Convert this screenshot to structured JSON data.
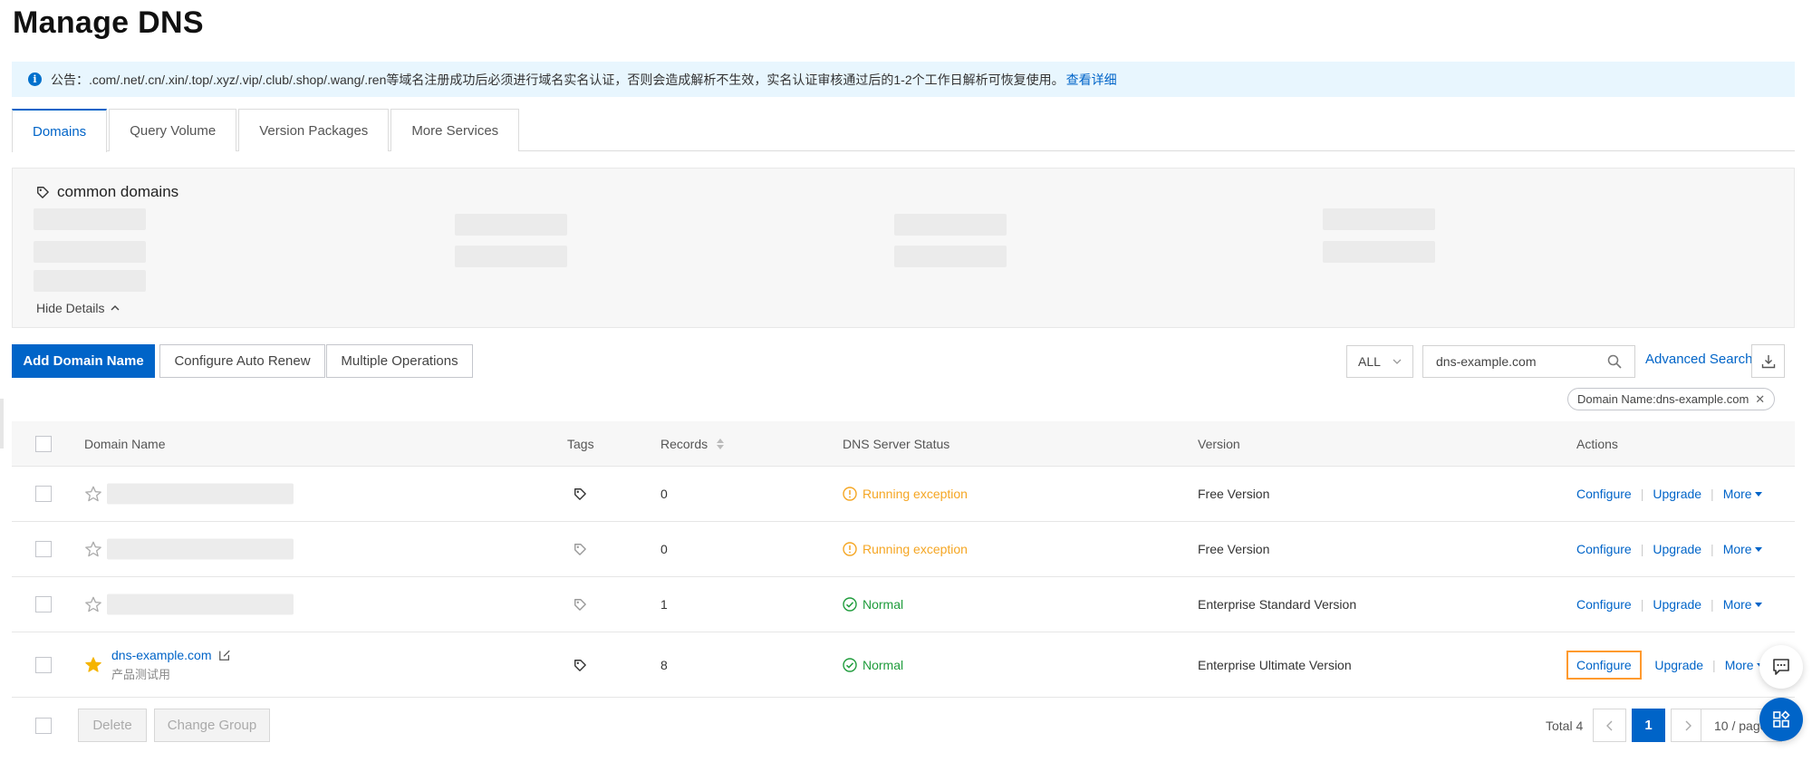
{
  "page": {
    "title": "Manage DNS"
  },
  "notice": {
    "text": "公告：.com/.net/.cn/.xin/.top/.xyz/.vip/.club/.shop/.wang/.ren等域名注册成功后必须进行域名实名认证，否则会造成解析不生效，实名认证审核通过后的1-2个工作日解析可恢复使用。",
    "link": "查看详细"
  },
  "tabs": [
    {
      "label": "Domains",
      "active": true
    },
    {
      "label": "Query Volume",
      "active": false
    },
    {
      "label": "Version Packages",
      "active": false
    },
    {
      "label": "More Services",
      "active": false
    }
  ],
  "common_domains": {
    "title": "common domains",
    "toggle": "Hide Details"
  },
  "toolbar": {
    "add_domain": "Add Domain Name",
    "auto_renew": "Configure Auto Renew",
    "multiple_ops": "Multiple Operations",
    "scope_select": "ALL",
    "search_value": "dns-example.com",
    "advanced_search": "Advanced Search",
    "filter_chip": "Domain Name:dns-example.com"
  },
  "table": {
    "headers": {
      "domain": "Domain Name",
      "tags": "Tags",
      "records": "Records",
      "status": "DNS Server Status",
      "version": "Version",
      "actions": "Actions"
    },
    "rows": [
      {
        "records": "0",
        "status": "Running exception",
        "status_type": "exception",
        "version": "Free Version"
      },
      {
        "records": "0",
        "status": "Running exception",
        "status_type": "exception",
        "version": "Free Version"
      },
      {
        "records": "1",
        "status": "Normal",
        "status_type": "normal",
        "version": "Enterprise Standard Version"
      },
      {
        "domain": "dns-example.com",
        "remark": "产品测试用",
        "starred": true,
        "records": "8",
        "status": "Normal",
        "status_type": "normal",
        "version": "Enterprise Ultimate Version"
      }
    ],
    "actions": {
      "configure": "Configure",
      "upgrade": "Upgrade",
      "more": "More"
    }
  },
  "footer": {
    "delete": "Delete",
    "change_group": "Change Group",
    "total": "Total 4",
    "current_page": "1",
    "page_size": "10 / page"
  },
  "colors": {
    "primary": "#0064c8",
    "warning": "#f5a623",
    "success": "#1f9c3c",
    "highlight": "#ff9a2e",
    "notice_bg": "#e8f6fe"
  }
}
